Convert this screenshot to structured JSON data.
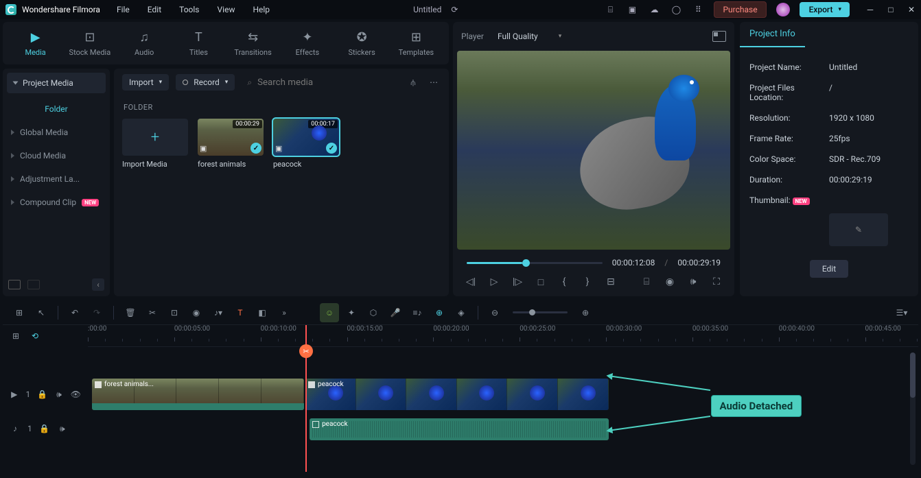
{
  "app": {
    "name": "Wondershare Filmora",
    "title": "Untitled"
  },
  "menus": [
    "File",
    "Edit",
    "Tools",
    "View",
    "Help"
  ],
  "titlebar": {
    "purchase": "Purchase",
    "export": "Export"
  },
  "panelTabs": [
    {
      "label": "Media",
      "icon": "media",
      "active": true
    },
    {
      "label": "Stock Media",
      "icon": "stock"
    },
    {
      "label": "Audio",
      "icon": "audio"
    },
    {
      "label": "Titles",
      "icon": "titles"
    },
    {
      "label": "Transitions",
      "icon": "trans"
    },
    {
      "label": "Effects",
      "icon": "fx"
    },
    {
      "label": "Stickers",
      "icon": "stk"
    },
    {
      "label": "Templates",
      "icon": "tmpl"
    }
  ],
  "side": {
    "projectMedia": "Project Media",
    "folder": "Folder",
    "items": [
      {
        "label": "Global Media"
      },
      {
        "label": "Cloud Media"
      },
      {
        "label": "Adjustment La..."
      },
      {
        "label": "Compound Clip",
        "badge": "NEW"
      }
    ]
  },
  "content": {
    "import": "Import",
    "record": "Record",
    "searchPh": "Search media",
    "folderTitle": "FOLDER",
    "cards": [
      {
        "name": "Import Media",
        "type": "import"
      },
      {
        "name": "forest animals",
        "type": "clip",
        "dur": "00:00:29",
        "sel": false,
        "bg": "forest"
      },
      {
        "name": "peacock",
        "type": "clip",
        "dur": "00:00:17",
        "sel": true,
        "bg": "peacock"
      }
    ]
  },
  "player": {
    "tab": "Player",
    "quality": "Full Quality",
    "current": "00:00:12:08",
    "total": "00:00:29:19"
  },
  "info": {
    "tab": "Project Info",
    "rows": [
      {
        "k": "Project Name:",
        "v": "Untitled"
      },
      {
        "k": "Project Files Location:",
        "v": "/"
      },
      {
        "k": "Resolution:",
        "v": "1920 x 1080"
      },
      {
        "k": "Frame Rate:",
        "v": "25fps"
      },
      {
        "k": "Color Space:",
        "v": "SDR - Rec.709"
      },
      {
        "k": "Duration:",
        "v": "00:00:29:19"
      }
    ],
    "thumbLabel": "Thumbnail:",
    "thumbBadge": "NEW",
    "edit": "Edit"
  },
  "timeline": {
    "ticks": [
      ":00:00",
      "00:00:05:00",
      "00:00:10:00",
      "00:00:15:00",
      "00:00:20:00",
      "00:00:25:00",
      "00:00:30:00",
      "00:00:35:00",
      "00:00:40:00",
      "00:00:45:00"
    ],
    "playheadPct": 26.2,
    "tracks": [
      {
        "type": "video",
        "num": "1",
        "clips": [
          {
            "label": "forest animals...",
            "leftPct": 0.5,
            "widthPct": 25.5,
            "bg": "forest"
          },
          {
            "label": "peacock",
            "leftPct": 26.2,
            "widthPct": 36.5,
            "bg": "peacock"
          }
        ]
      },
      {
        "type": "audio",
        "num": "1",
        "clips": [
          {
            "label": "peacock",
            "leftPct": 26.7,
            "widthPct": 36
          }
        ]
      }
    ],
    "annot": "Audio Detached"
  }
}
